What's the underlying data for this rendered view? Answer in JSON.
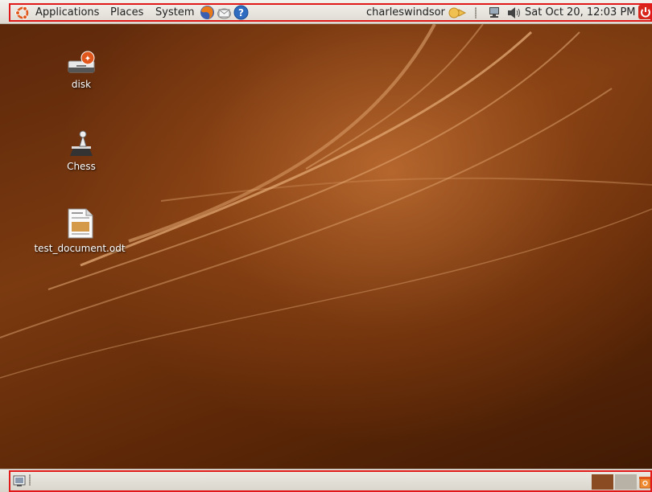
{
  "top_panel": {
    "menus": [
      {
        "label": "Applications"
      },
      {
        "label": "Places"
      },
      {
        "label": "System"
      }
    ],
    "launchers": [
      "firefox-icon",
      "mail-icon",
      "help-icon"
    ],
    "user": "charleswindsor",
    "clock": "Sat Oct 20, 12:03 PM",
    "status_icons": [
      "network-icon",
      "volume-icon",
      "shutdown-icon"
    ]
  },
  "desktop": {
    "icons": [
      {
        "label": "disk",
        "icon": "drive-icon"
      },
      {
        "label": "Chess",
        "icon": "chess-icon"
      },
      {
        "label": "test_document.odt",
        "icon": "document-icon"
      }
    ]
  },
  "bottom_panel": {
    "workspaces": [
      {
        "color": "#8a4a22",
        "active": true
      },
      {
        "color": "#b8b2a6",
        "active": false
      }
    ]
  },
  "colors": {
    "accent": "#e01818",
    "ubuntu_orange": "#e0561b",
    "panel": "#e6e3dc"
  }
}
